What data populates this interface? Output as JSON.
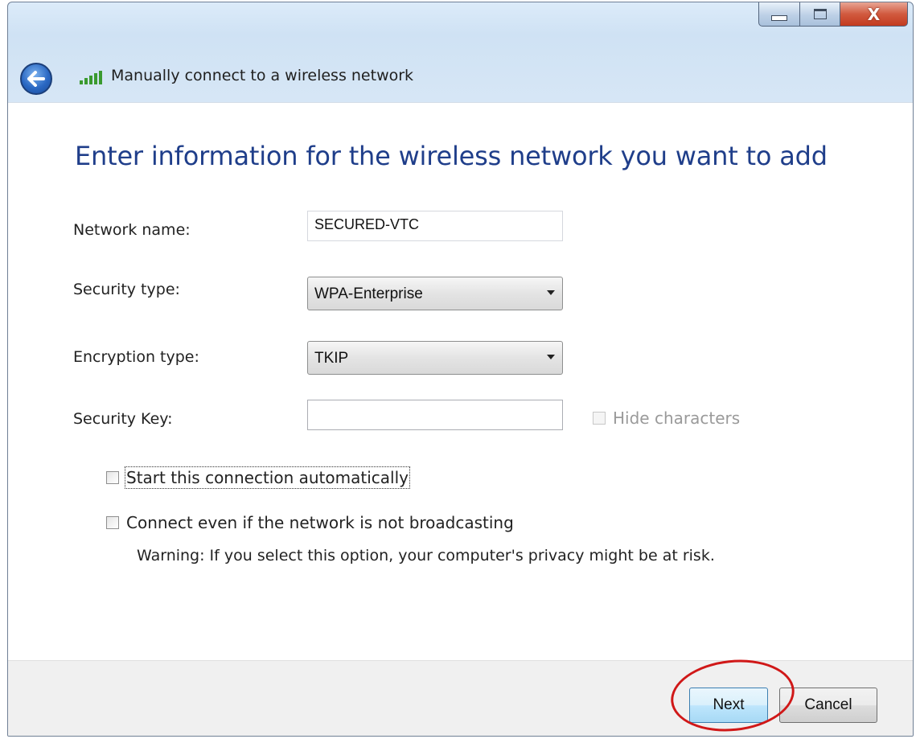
{
  "window": {
    "caption": {
      "minimize_icon": "minimize-icon",
      "maximize_icon": "maximize-icon",
      "close_symbol": "X"
    }
  },
  "nav": {
    "back_icon": "back-arrow-icon",
    "signal_icon": "wireless-signal-icon",
    "title": "Manually connect to a wireless network"
  },
  "main": {
    "heading": "Enter information for the wireless network you want to add",
    "fields": {
      "network_name": {
        "label": "Network name:",
        "value": "SECURED-VTC"
      },
      "security_type": {
        "label": "Security type:",
        "value": "WPA-Enterprise"
      },
      "encryption_type": {
        "label": "Encryption type:",
        "value": "TKIP"
      },
      "security_key": {
        "label": "Security Key:",
        "value": ""
      }
    },
    "hide_characters": {
      "label": "Hide characters",
      "checked": false,
      "enabled": false
    },
    "options": {
      "start_automatically": {
        "label": "Start this connection automatically",
        "checked": false
      },
      "connect_not_broadcasting": {
        "label": "Connect even if the network is not broadcasting",
        "checked": false
      },
      "warning": "Warning: If you select this option, your computer's privacy might be at risk."
    }
  },
  "footer": {
    "next_label": "Next",
    "cancel_label": "Cancel"
  },
  "colors": {
    "heading": "#1f3e8a",
    "highlight_ring": "#d01818"
  }
}
